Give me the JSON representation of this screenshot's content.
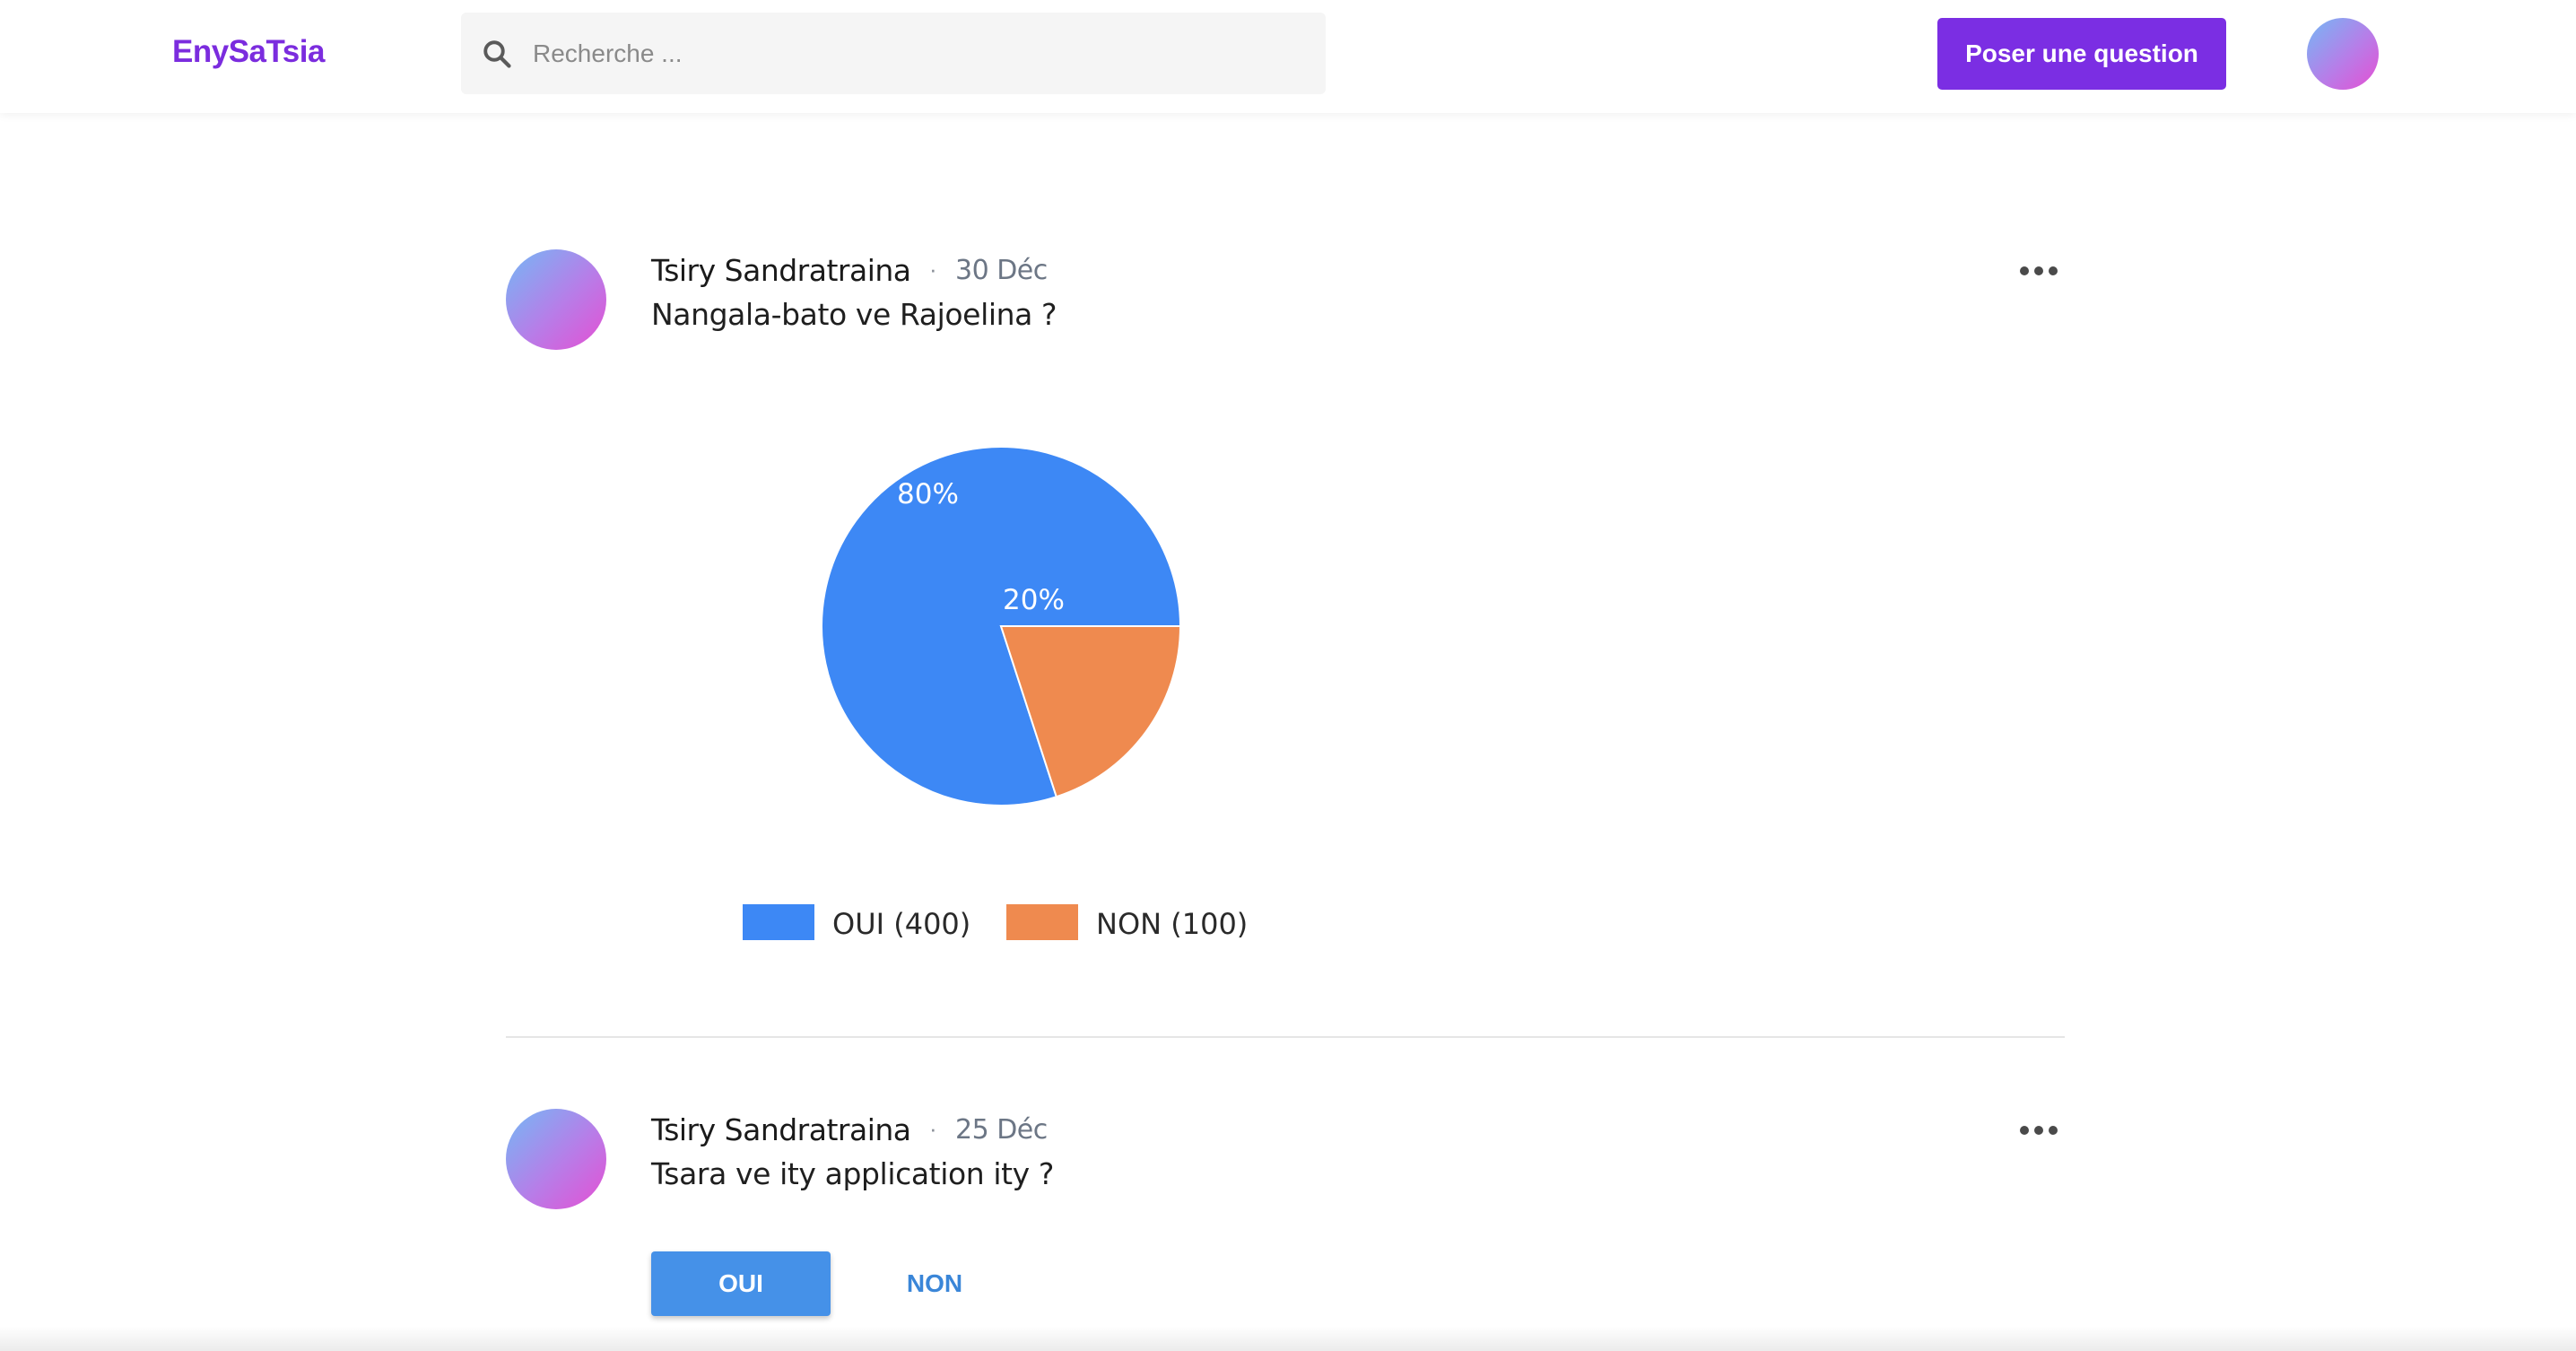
{
  "header": {
    "logo": "EnySaTsia",
    "search_placeholder": "Recherche ...",
    "ask_button": "Poser une question"
  },
  "posts": [
    {
      "author": "Tsiry Sandratraina",
      "separator": "·",
      "date": "30 Déc",
      "question": "Nangala-bato ve Rajoelina ?"
    },
    {
      "author": "Tsiry Sandratraina",
      "separator": "·",
      "date": "25 Déc",
      "question": "Tsara ve ity application ity ?",
      "options": [
        "OUI",
        "NON"
      ]
    }
  ],
  "chart_data": {
    "type": "pie",
    "categories": [
      "OUI",
      "NON"
    ],
    "values": [
      400,
      100
    ],
    "percent_labels": [
      "80%",
      "20%"
    ],
    "legend": [
      "OUI (400)",
      "NON (100)"
    ],
    "colors": [
      "#3d88f5",
      "#ef8a4f"
    ],
    "legend_placement": "bottom"
  },
  "colors": {
    "brand": "#7b2cde",
    "primary_button": "#7b2ee3",
    "answer_button": "#4591e8"
  }
}
